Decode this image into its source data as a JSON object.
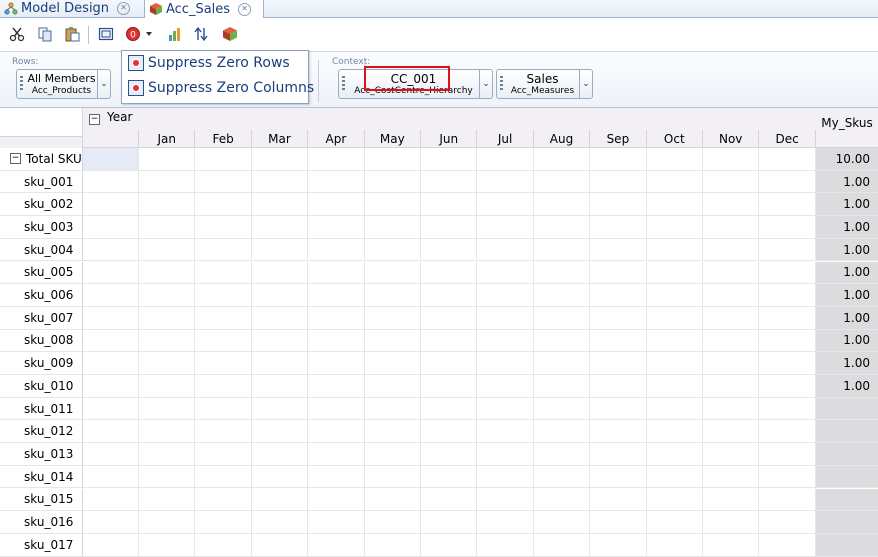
{
  "tabs": [
    {
      "label": "Model Design",
      "icon": "model-design-icon"
    },
    {
      "label": "Acc_Sales",
      "icon": "cube-icon"
    }
  ],
  "toolbar": {
    "icons": [
      "cut-icon",
      "copy-icon",
      "paste-icon",
      "view-options-icon",
      "suppress-zero-icon",
      "dropdown-arrow-icon",
      "chart-icon",
      "swap-axes-icon",
      "cube-settings-icon"
    ]
  },
  "rows_label": "Rows:",
  "context_label": "Context:",
  "rows_selector": {
    "value": "All Members",
    "dimension": "Acc_Products"
  },
  "column_selector_hidden": {
    "value": "",
    "dimension": ""
  },
  "context_selectors": [
    {
      "value": "CC_001",
      "dimension": "Acc_CostCentre_Hierarchy"
    },
    {
      "value": "Sales",
      "dimension": "Acc_Measures"
    }
  ],
  "suppress_menu": [
    "Suppress Zero Rows",
    "Suppress Zero Columns"
  ],
  "grid": {
    "column_dimension": "Year",
    "months": [
      "Jan",
      "Feb",
      "Mar",
      "Apr",
      "May",
      "Jun",
      "Jul",
      "Aug",
      "Sep",
      "Oct",
      "Nov",
      "Dec"
    ],
    "measure_header": "My_Skus",
    "rows": [
      {
        "label": "Total SKU",
        "value": "10.00"
      },
      {
        "label": "sku_001",
        "value": "1.00"
      },
      {
        "label": "sku_002",
        "value": "1.00"
      },
      {
        "label": "sku_003",
        "value": "1.00"
      },
      {
        "label": "sku_004",
        "value": "1.00"
      },
      {
        "label": "sku_005",
        "value": "1.00"
      },
      {
        "label": "sku_006",
        "value": "1.00"
      },
      {
        "label": "sku_007",
        "value": "1.00"
      },
      {
        "label": "sku_008",
        "value": "1.00"
      },
      {
        "label": "sku_009",
        "value": "1.00"
      },
      {
        "label": "sku_010",
        "value": "1.00"
      },
      {
        "label": "sku_011",
        "value": ""
      },
      {
        "label": "sku_012",
        "value": ""
      },
      {
        "label": "sku_013",
        "value": ""
      },
      {
        "label": "sku_014",
        "value": ""
      },
      {
        "label": "sku_015",
        "value": ""
      },
      {
        "label": "sku_016",
        "value": ""
      },
      {
        "label": "sku_017",
        "value": ""
      }
    ]
  },
  "colors": {
    "highlight_box": "#e0101a",
    "measure_column": "#dcdcde",
    "header_bg": "#f3f0f5"
  }
}
